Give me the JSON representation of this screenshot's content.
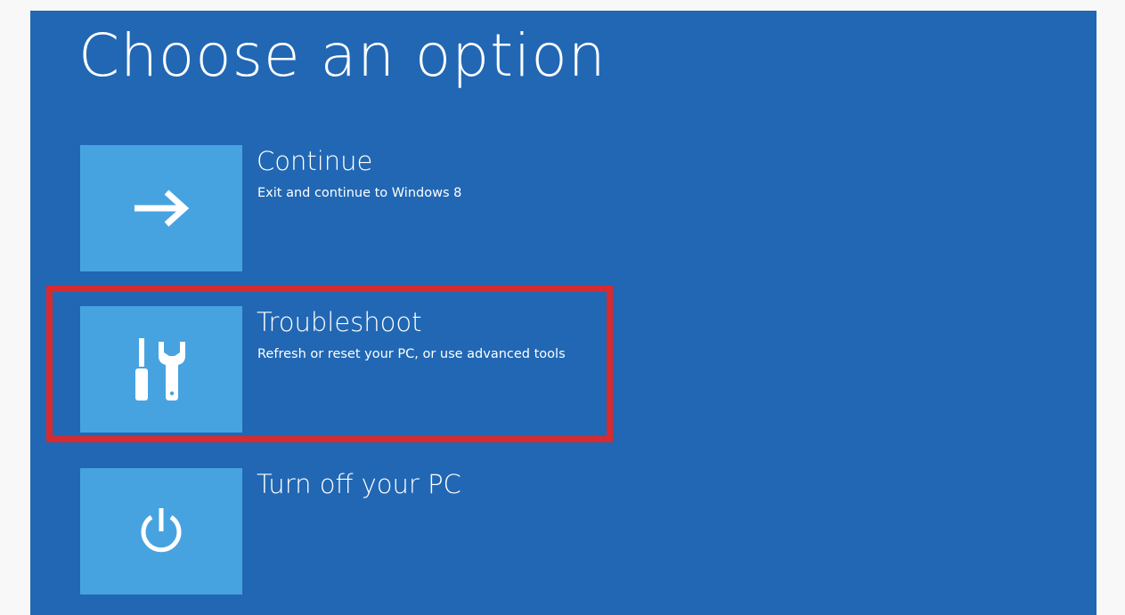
{
  "page": {
    "title": "Choose an option"
  },
  "options": [
    {
      "label": "Continue",
      "description": "Exit and continue to Windows 8",
      "icon": "arrow-right-icon"
    },
    {
      "label": "Troubleshoot",
      "description": "Refresh or reset your PC, or use advanced tools",
      "icon": "tools-icon"
    },
    {
      "label": "Turn off your PC",
      "description": "",
      "icon": "power-icon"
    }
  ],
  "colors": {
    "background": "#2167b4",
    "tile": "#47a3e0",
    "highlight": "#d72b30",
    "text": "#ffffff"
  }
}
